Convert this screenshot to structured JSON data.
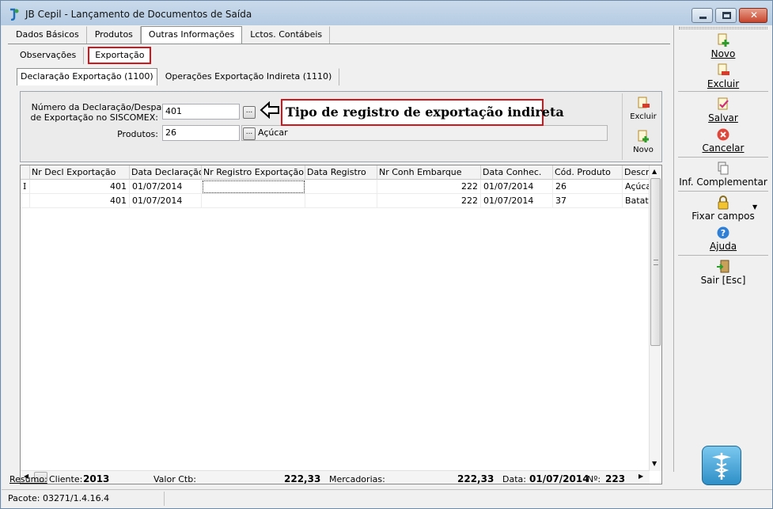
{
  "window": {
    "title": "JB Cepil - Lançamento de Documentos de Saída"
  },
  "tabs": [
    "Dados Básicos",
    "Produtos",
    "Outras Informações",
    "Lctos. Contábeis"
  ],
  "subtabs": [
    "Observações",
    "Exportação"
  ],
  "subsubtabs": [
    "Declaração Exportação (1100)",
    "Operações Exportação Indireta (1110)"
  ],
  "form": {
    "declaracao_label_1": "Número da Declaração/Despacho",
    "declaracao_label_2": "de Exportação no SISCOMEX:",
    "declaracao_value": "401",
    "produtos_label": "Produtos:",
    "produtos_value": "26",
    "produtos_desc": "Açúcar",
    "browse_label": "..."
  },
  "annotation": {
    "text": "Tipo de registro de exportação indireta"
  },
  "side_buttons": {
    "excluir": "Excluir",
    "novo": "Novo"
  },
  "grid": {
    "columns": [
      "Nr Decl Exportação",
      "Data Declaração",
      "Nr Registro Exportação",
      "Data Registro",
      "Nr Conh Embarque",
      "Data Conhec.",
      "Cód. Produto",
      "Descri"
    ],
    "rows": [
      [
        "401",
        "01/07/2014",
        "",
        "",
        "222",
        "01/07/2014",
        "26",
        "Açúca"
      ],
      [
        "401",
        "01/07/2014",
        "",
        "",
        "222",
        "01/07/2014",
        "37",
        "Batata"
      ]
    ]
  },
  "status": {
    "resumo": "Resumo:",
    "cliente_label": "Cliente:",
    "cliente_value": "2013",
    "valor_ctb_label": "Valor Ctb:",
    "valor_ctb_value": "222,33",
    "mercadorias_label": "Mercadorias:",
    "mercadorias_value": "222,33",
    "data_label": "Data:",
    "data_value": "01/07/2014",
    "numero_label": "Nº:",
    "numero_value": "223",
    "pacote": "Pacote: 03271/1.4.16.4"
  },
  "right_panel": {
    "novo": "Novo",
    "excluir": "Excluir",
    "salvar": "Salvar",
    "cancelar": "Cancelar",
    "inf_complementar": "Inf. Complementar",
    "fixar_campos": "Fixar campos",
    "ajuda": "Ajuda",
    "sair": "Sair [Esc]"
  },
  "colors": {
    "accent_red": "#d2161c",
    "title_bar": "#b5cbe2"
  }
}
